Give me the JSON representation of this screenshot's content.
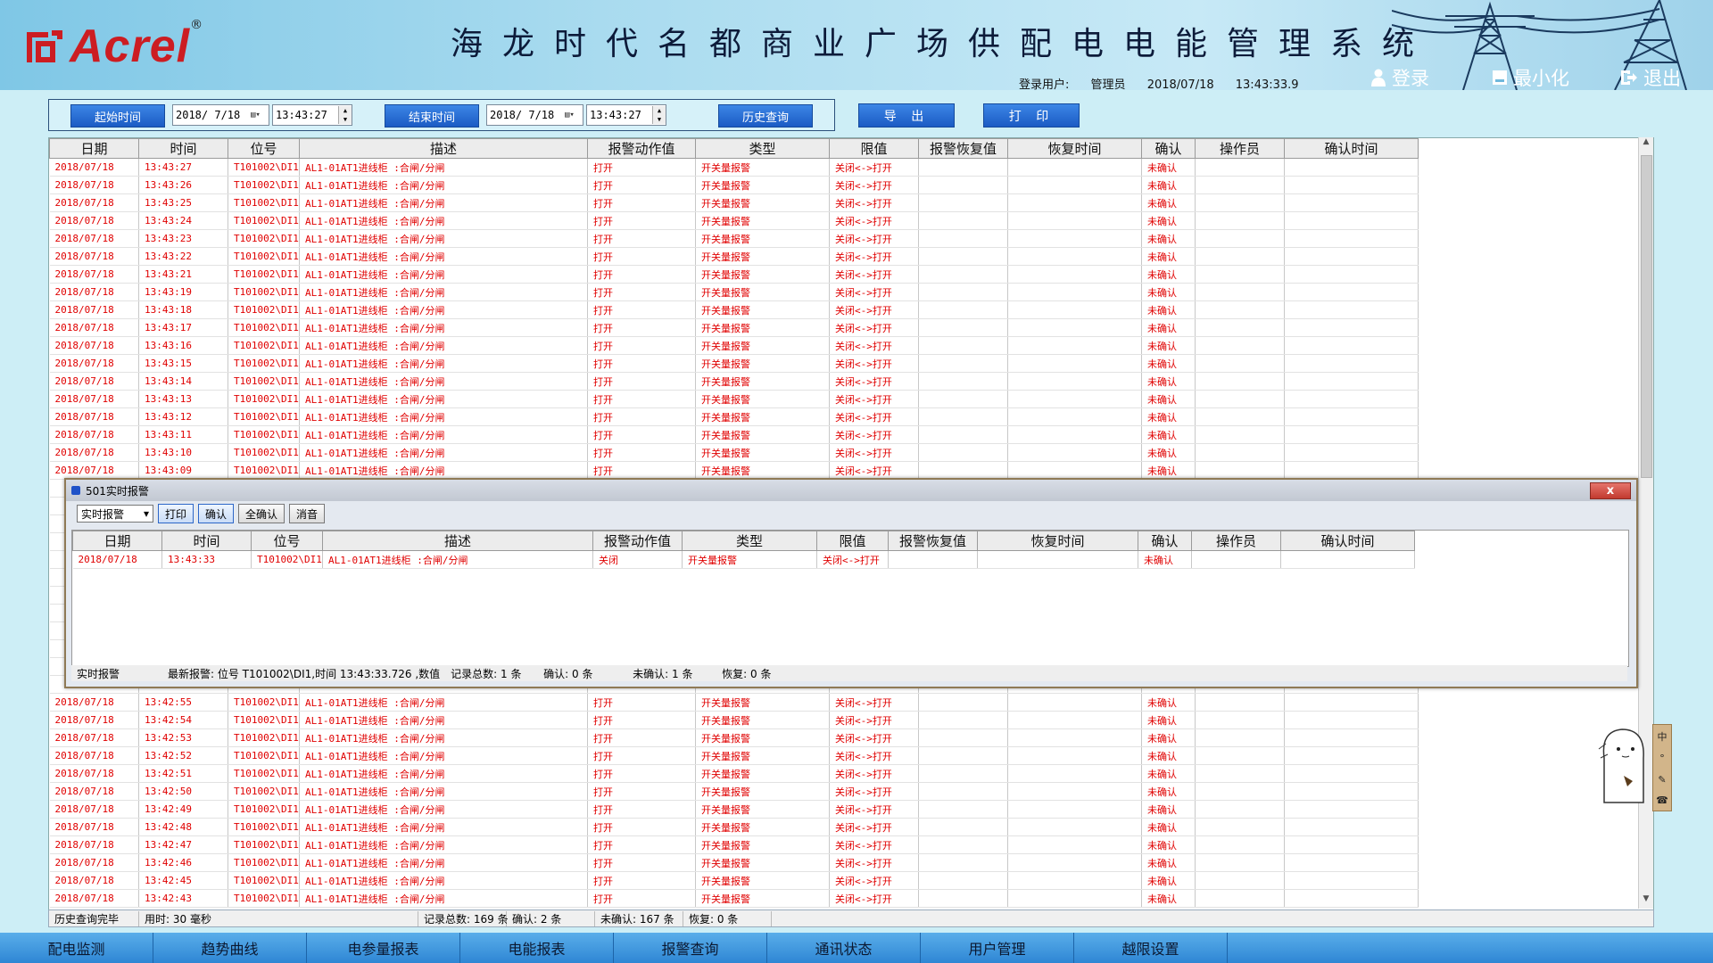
{
  "header": {
    "logo_text": "Acrel",
    "logo_mark": "®",
    "title": "海龙时代名都商业广场供配电电能管理系统",
    "user_label": "登录用户:",
    "user_name": "管理员",
    "date": "2018/07/18",
    "time": "13:43:33.9",
    "login_label": "登录",
    "minimize_label": "最小化",
    "exit_label": "退出"
  },
  "toolbar": {
    "start_label": "起始时间",
    "start_date": "2018/ 7/18",
    "start_time": "13:43:27",
    "end_label": "结束时间",
    "end_date": "2018/ 7/18",
    "end_time": "13:43:27",
    "history_label": "历史查询",
    "export_label": "导 出",
    "print_label": "打 印"
  },
  "grid_columns": [
    "日期",
    "时间",
    "位号",
    "描述",
    "报警动作值",
    "类型",
    "限值",
    "报警恢复值",
    "恢复时间",
    "确认",
    "操作员",
    "确认时间"
  ],
  "alarm_common": {
    "date": "2018/07/18",
    "tag": "T101002\\DI1",
    "desc": "AL1-01AT1进线柜 :合闸/分闸",
    "action": "打开",
    "type": "开关量报警",
    "limit": "关闭<->打开",
    "restore_value": "",
    "restore_time": "",
    "confirm": "未确认",
    "operator": "",
    "confirm_time": ""
  },
  "alarm_times_top": [
    "13:43:27",
    "13:43:26",
    "13:43:25",
    "13:43:24",
    "13:43:23",
    "13:43:22",
    "13:43:21",
    "13:43:19",
    "13:43:18",
    "13:43:17",
    "13:43:16",
    "13:43:15",
    "13:43:14",
    "13:43:13",
    "13:43:12",
    "13:43:11",
    "13:43:10",
    "13:43:09"
  ],
  "alarm_times_bottom": [
    "13:42:55",
    "13:42:54",
    "13:42:53",
    "13:42:52",
    "13:42:51",
    "13:42:50",
    "13:42:49",
    "13:42:48",
    "13:42:47",
    "13:42:46",
    "13:42:45",
    "13:42:43"
  ],
  "main_status": {
    "state": "历史查询完毕",
    "elapsed": "用时: 30 毫秒",
    "total": "记录总数: 169 条",
    "confirmed": "确认: 2 条",
    "unconfirmed": "未确认: 167 条",
    "restored": "恢复: 0 条"
  },
  "popup": {
    "title": "501实时报警",
    "close_label": "x",
    "mode_select": "实时报警",
    "print_label": "打印",
    "confirm_label": "确认",
    "confirm_all_label": "全确认",
    "mute_label": "消音",
    "row": {
      "date": "2018/07/18",
      "time": "13:43:33",
      "tag": "T101002\\DI1",
      "desc": "AL1-01AT1进线柜 :合闸/分闸",
      "action": "关闭",
      "type": "开关量报警",
      "limit": "关闭<->打开",
      "restore_value": "",
      "restore_time": "",
      "confirm": "未确认",
      "operator": "",
      "confirm_time": ""
    },
    "status": {
      "mode": "实时报警",
      "latest": "最新报警: 位号 T101002\\DI1,时间 13:43:33.726 ,数值",
      "total": "记录总数: 1 条",
      "confirmed": "确认: 0 条",
      "unconfirmed": "未确认: 1 条",
      "restored": "恢复: 0 条"
    }
  },
  "ime_bar": [
    "中",
    "°",
    "✎",
    "☎"
  ],
  "bottom_nav": [
    "配电监测",
    "趋势曲线",
    "电参量报表",
    "电能报表",
    "报警查询",
    "通讯状态",
    "用户管理",
    "越限设置"
  ],
  "colors": {
    "alarm_text": "#e00000",
    "brand_red": "#cc1d22",
    "nav_blue": "#3b93dc"
  }
}
